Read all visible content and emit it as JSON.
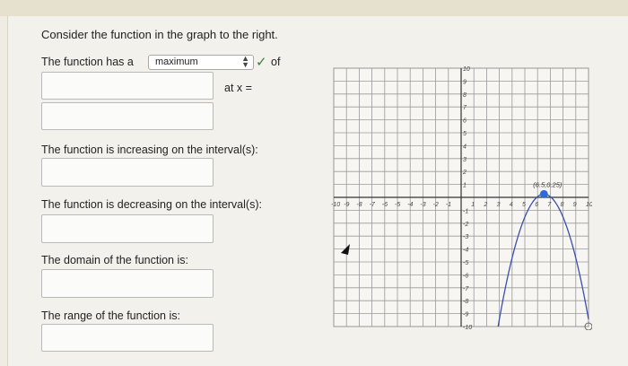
{
  "question": {
    "prompt": "Consider the function in the graph to the right.",
    "has_a_label": "The function has a",
    "extremum_select": {
      "selected": "maximum"
    },
    "of_label": "of",
    "at_x_label": "at x =",
    "increasing_label": "The function is increasing on the interval(s):",
    "decreasing_label": "The function is decreasing on the interval(s):",
    "domain_label": "The domain of the function is:",
    "range_label": "The range of the function is:"
  },
  "graph": {
    "x_ticks": [
      "-10",
      "-9",
      "-8",
      "-7",
      "-6",
      "-5",
      "-4",
      "-3",
      "-2",
      "-1",
      "1",
      "2",
      "3",
      "4",
      "5",
      "6",
      "7",
      "8",
      "9",
      "10"
    ],
    "y_ticks": [
      "10",
      "9",
      "8",
      "7",
      "6",
      "5",
      "4",
      "3",
      "2",
      "1",
      "-1",
      "-2",
      "-3",
      "-4",
      "-5",
      "-6",
      "-7",
      "-8",
      "-9",
      "-10"
    ],
    "vertex_label": "(6.5,0.25)",
    "vertex": {
      "x": 6.5,
      "y": 0.25
    },
    "curve_start": {
      "x": 2.9,
      "y": -10
    },
    "curve_end": {
      "x": 10,
      "y": -10
    },
    "accent_color": "#2f6bd6"
  }
}
